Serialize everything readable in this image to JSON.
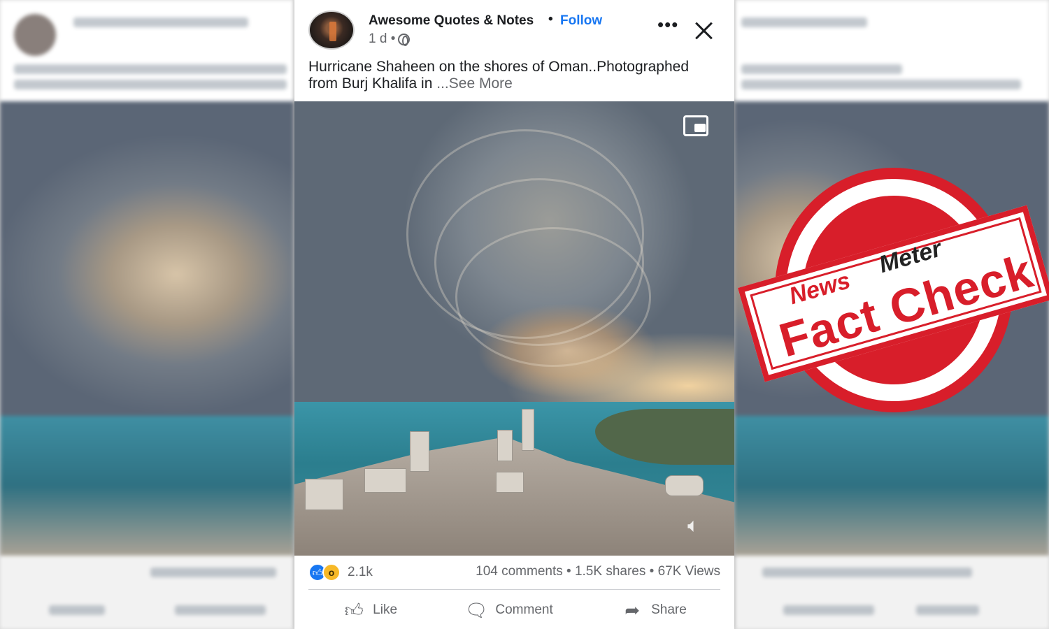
{
  "post": {
    "page_name": "Awesome Quotes & Notes",
    "separator": "•",
    "follow_label": "Follow",
    "time": "1 d •",
    "caption": "Hurricane Shaheen on the shores of Oman..Photographed from Burj Khalifa in ",
    "see_more": "...See More",
    "reaction_count": "2.1k",
    "stats": "104 comments • 1.5K shares • 67K Views",
    "actions": {
      "like": "Like",
      "comment": "Comment",
      "share": "Share"
    }
  },
  "icons": {
    "privacy": "globe-icon",
    "more": "more-options-icon",
    "close": "close-icon",
    "pip": "picture-in-picture-icon",
    "sound": "speaker-icon",
    "like": "thumbs-up-icon",
    "comment": "comment-bubble-icon",
    "share": "share-arrow-icon"
  },
  "stamp": {
    "brand_news": "News",
    "brand_meter": "Meter",
    "label": "Fact Check"
  },
  "colors": {
    "accent": "#1877f2",
    "stamp_red": "#d81e2a",
    "text": "#1c1e21",
    "muted": "#65676b"
  }
}
